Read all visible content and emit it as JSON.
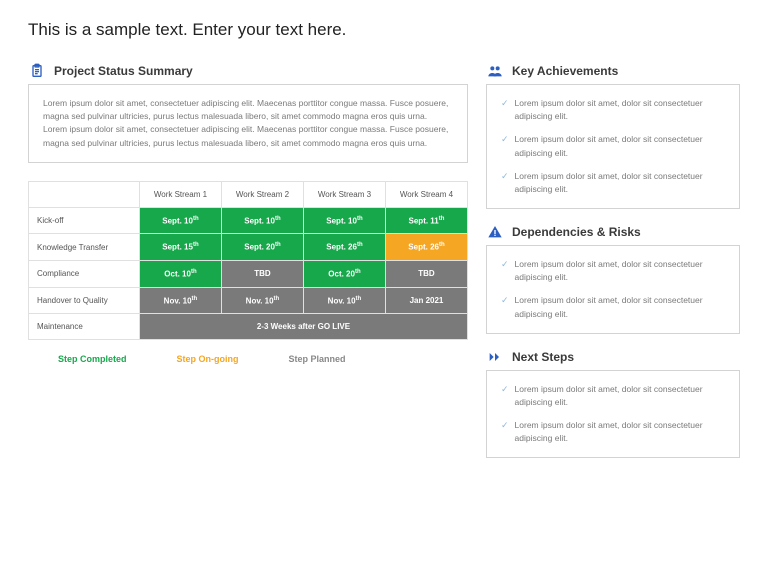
{
  "title": "This is a sample text. Enter your text here.",
  "status": {
    "heading": "Project Status Summary",
    "text": "Lorem ipsum dolor sit amet, consectetuer adipiscing elit. Maecenas porttitor congue massa. Fusce posuere, magna sed pulvinar ultricies, purus lectus malesuada libero, sit amet commodo magna eros quis urna. Lorem ipsum dolor sit amet, consectetuer adipiscing elit. Maecenas porttitor congue massa. Fusce posuere, magna sed pulvinar ultricies, purus lectus malesuada libero, sit amet commodo magna eros quis urna."
  },
  "table": {
    "headers": [
      "",
      "Work Stream 1",
      "Work Stream 2",
      "Work Stream 3",
      "Work Stream 4"
    ],
    "rows": [
      {
        "label": "Kick-off",
        "cells": [
          {
            "v": "Sept. 10",
            "sup": "th",
            "c": "g"
          },
          {
            "v": "Sept. 10",
            "sup": "th",
            "c": "g"
          },
          {
            "v": "Sept. 10",
            "sup": "th",
            "c": "g"
          },
          {
            "v": "Sept. 11",
            "sup": "th",
            "c": "g"
          }
        ]
      },
      {
        "label": "Knowledge Transfer",
        "cells": [
          {
            "v": "Sept. 15",
            "sup": "th",
            "c": "g"
          },
          {
            "v": "Sept. 20",
            "sup": "th",
            "c": "g"
          },
          {
            "v": "Sept. 26",
            "sup": "th",
            "c": "g"
          },
          {
            "v": "Sept. 26",
            "sup": "th",
            "c": "y"
          }
        ]
      },
      {
        "label": "Compliance",
        "cells": [
          {
            "v": "Oct. 10",
            "sup": "th",
            "c": "g"
          },
          {
            "v": "TBD",
            "sup": "",
            "c": "gr"
          },
          {
            "v": "Oct. 20",
            "sup": "th",
            "c": "g"
          },
          {
            "v": "TBD",
            "sup": "",
            "c": "gr"
          }
        ]
      },
      {
        "label": "Handover to Quality",
        "cells": [
          {
            "v": "Nov. 10",
            "sup": "th",
            "c": "gr"
          },
          {
            "v": "Nov. 10",
            "sup": "th",
            "c": "gr"
          },
          {
            "v": "Nov. 10",
            "sup": "th",
            "c": "gr"
          },
          {
            "v": "Jan 2021",
            "sup": "",
            "c": "gr"
          }
        ]
      }
    ],
    "maintenance": {
      "label": "Maintenance",
      "text": "2-3 Weeks after GO LIVE"
    }
  },
  "legend": {
    "completed": "Step Completed",
    "ongoing": "Step On-going",
    "planned": "Step Planned"
  },
  "achievements": {
    "heading": "Key Achievements",
    "items": [
      "Lorem ipsum dolor sit amet, dolor sit consectetuer adipiscing elit.",
      "Lorem ipsum dolor sit amet, dolor sit consectetuer adipiscing elit.",
      "Lorem ipsum dolor sit amet, dolor sit consectetuer adipiscing elit."
    ]
  },
  "risks": {
    "heading": "Dependencies & Risks",
    "items": [
      "Lorem ipsum dolor sit amet, dolor sit consectetuer adipiscing elit.",
      "Lorem ipsum dolor sit amet, dolor sit consectetuer adipiscing elit."
    ]
  },
  "next": {
    "heading": "Next Steps",
    "items": [
      "Lorem ipsum dolor sit amet, dolor sit consectetuer adipiscing elit.",
      "Lorem ipsum dolor sit amet, dolor sit consectetuer adipiscing elit."
    ]
  }
}
